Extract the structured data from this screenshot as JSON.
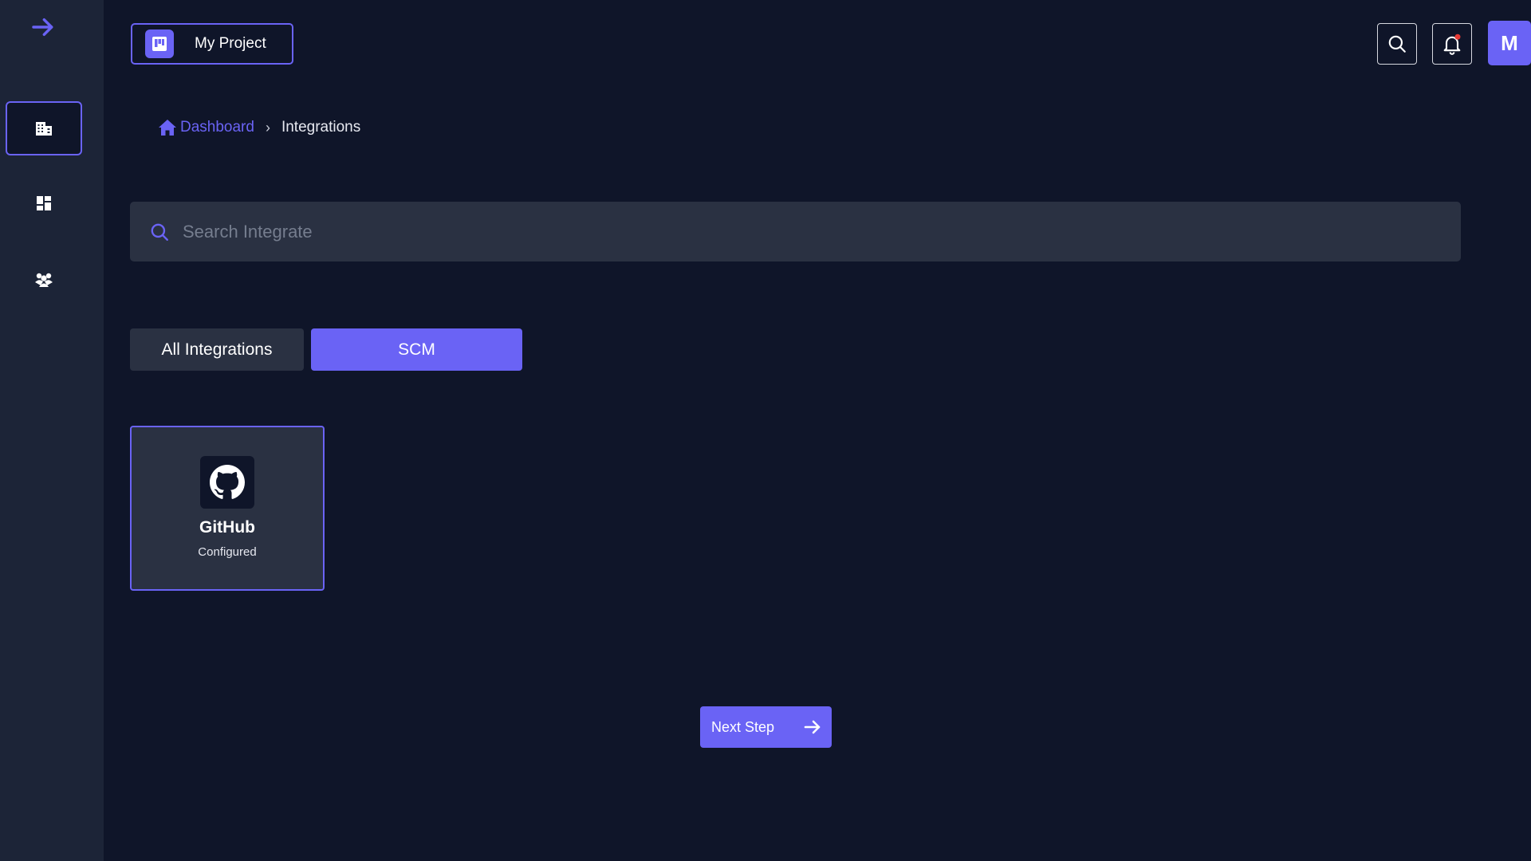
{
  "sidebar": {
    "toggle_icon": "arrow-right-icon",
    "items": [
      {
        "icon": "building-icon",
        "active": true
      },
      {
        "icon": "dashboard-grid-icon",
        "active": false
      },
      {
        "icon": "team-icon",
        "active": false
      }
    ]
  },
  "header": {
    "project_name": "My Project",
    "project_icon": "board-icon",
    "search_icon": "search-icon",
    "notification_icon": "bell-icon",
    "avatar_initial": "M"
  },
  "breadcrumb": {
    "home_label": "Dashboard",
    "separator": "›",
    "current": "Integrations"
  },
  "search": {
    "placeholder": "Search Integrate",
    "value": ""
  },
  "tabs": [
    {
      "label": "All Integrations",
      "active": false
    },
    {
      "label": "SCM",
      "active": true
    }
  ],
  "integrations": [
    {
      "name": "GitHub",
      "status": "Configured",
      "icon": "github-icon"
    }
  ],
  "actions": {
    "next_label": "Next Step"
  },
  "colors": {
    "background": "#0f1529",
    "sidebar": "#1c2437",
    "surface": "#2a3142",
    "accent": "#6a63f5",
    "notification_dot": "#e53935"
  }
}
